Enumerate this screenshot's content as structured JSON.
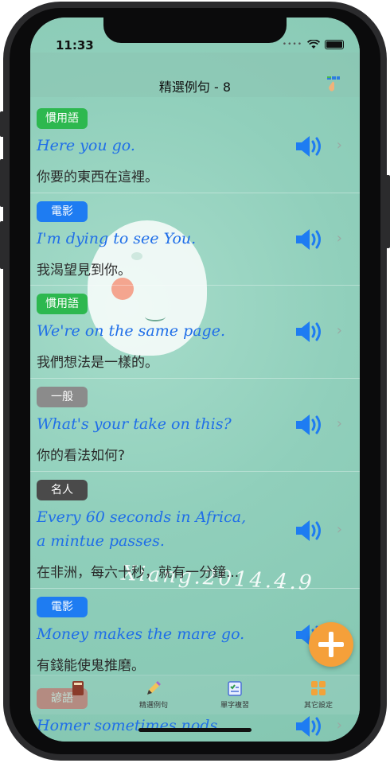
{
  "status": {
    "time": "11:33"
  },
  "nav": {
    "title": "精選例句 - 8"
  },
  "rows": [
    {
      "tag": "慣用語",
      "en": "Here you go.",
      "zh": "你要的東西在這裡。"
    },
    {
      "tag": "電影",
      "en": "I'm dying to see You.",
      "zh": "我渴望見到你。"
    },
    {
      "tag": "慣用語",
      "en": "We're on the same page.",
      "zh": "我們想法是一樣的。"
    },
    {
      "tag": "一般",
      "en": "What's your take on this?",
      "zh": "你的看法如何?"
    },
    {
      "tag": "名人",
      "en": "Every 60 seconds in Africa,",
      "en2": "a mintue passes.",
      "zh": "在非洲，每六十秒，就有一分鐘..."
    },
    {
      "tag": "電影",
      "en": "Money makes the mare go.",
      "zh": "有錢能使鬼推磨。"
    },
    {
      "tag": "諺語",
      "en": "Homer sometimes nods."
    }
  ],
  "tabs": [
    "精選例句",
    "單字複習",
    "其它設定"
  ],
  "signature": "Xiang.2014.4.9",
  "colors": {
    "green_tag": "#2db84f",
    "blue_tag": "#1e7cf2",
    "gray_tag": "#8b8b8b",
    "dark_tag": "#4a4a4a",
    "red_tag": "#e12a2a",
    "english_text": "#1f6ee8",
    "speaker": "#1e7cf2",
    "fab": "#f5a03a"
  },
  "icons": {
    "speaker": "speaker-icon",
    "chevron": "chevron-right-icon",
    "fab": "plus-icon",
    "nav": "cards-icon"
  }
}
